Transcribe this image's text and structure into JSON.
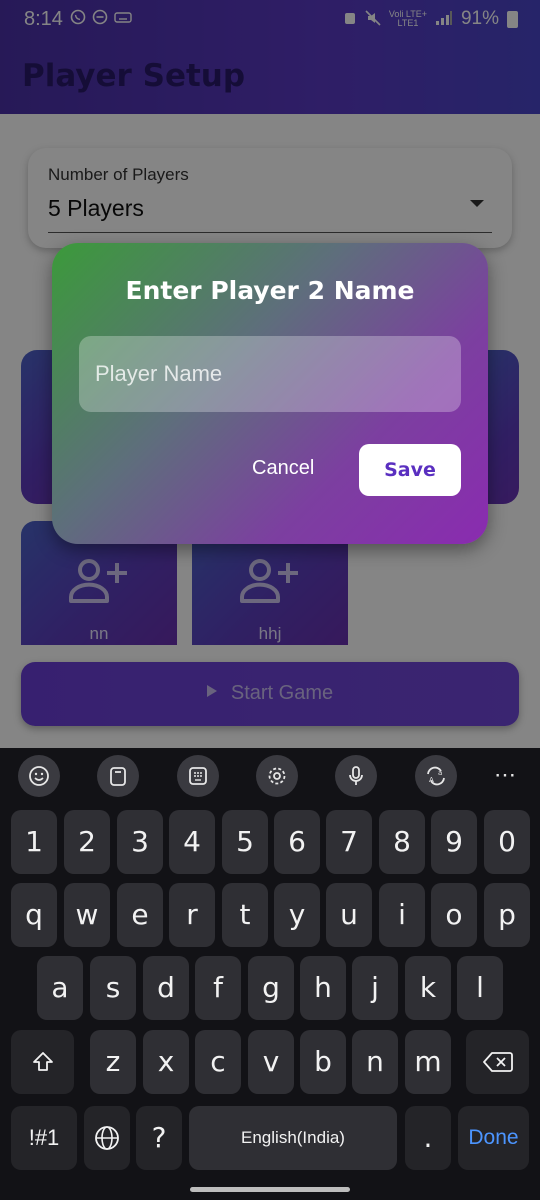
{
  "status_bar": {
    "time": "8:14",
    "left_icons": [
      "whatsapp-icon",
      "do-not-disturb-icon",
      "keyboard-icon"
    ],
    "network_line1": "Voli LTE+",
    "network_line2": "LTE1",
    "battery": "91%"
  },
  "app_bar": {
    "title": "Player Setup"
  },
  "player_count": {
    "label": "Number of Players",
    "value": "5 Players"
  },
  "player_tiles": [
    {
      "name": "nn"
    },
    {
      "name": "hhj"
    }
  ],
  "start_button": {
    "label": "Start Game"
  },
  "dialog": {
    "title": "Enter Player 2 Name",
    "input_placeholder": "Player Name",
    "input_value": "",
    "cancel_label": "Cancel",
    "save_label": "Save"
  },
  "keyboard": {
    "toolbar": [
      "emoji-icon",
      "clipboard-icon",
      "keypad-icon",
      "settings-icon",
      "microphone-icon",
      "translate-icon",
      "more-icon"
    ],
    "row_numbers": [
      "1",
      "2",
      "3",
      "4",
      "5",
      "6",
      "7",
      "8",
      "9",
      "0"
    ],
    "row_top": [
      "q",
      "w",
      "e",
      "r",
      "t",
      "y",
      "u",
      "i",
      "o",
      "p"
    ],
    "row_mid": [
      "a",
      "s",
      "d",
      "f",
      "g",
      "h",
      "j",
      "k",
      "l"
    ],
    "row_bottom": [
      "z",
      "x",
      "c",
      "v",
      "b",
      "n",
      "m"
    ],
    "symbols_label": "!#1",
    "question_key": "?",
    "space_label": "English(India)",
    "period_key": ".",
    "done_label": "Done"
  },
  "colors": {
    "accent": "#5a3ac4",
    "save_text": "#5a2fc0",
    "done_text": "#4c95ff"
  }
}
